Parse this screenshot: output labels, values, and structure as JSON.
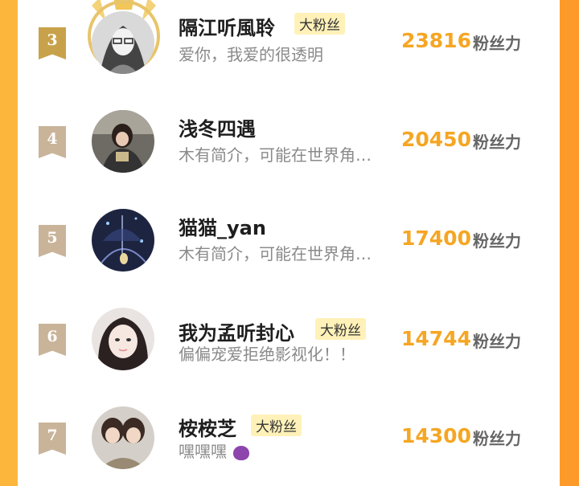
{
  "colors": {
    "accent": "#f5a623",
    "rank_gold": "#c8a24a",
    "rank_other": "#c9b49a",
    "badge_bg": "#fff1b8",
    "frame": "#fdb63c"
  },
  "rows": [
    {
      "rank": "3",
      "name": "隔江听風聆",
      "badge": "大粉丝",
      "bio": "爱你，我爱的很透明",
      "score": "23816",
      "unit": "粉丝力"
    },
    {
      "rank": "4",
      "name": "浅冬四遇",
      "badge": "",
      "bio": "木有简介，可能在世界角…",
      "score": "20450",
      "unit": "粉丝力"
    },
    {
      "rank": "5",
      "name": "猫猫_yan",
      "badge": "",
      "bio": "木有简介，可能在世界角…",
      "score": "17400",
      "unit": "粉丝力"
    },
    {
      "rank": "6",
      "name": "我为孟听封心",
      "badge": "大粉丝",
      "bio": "偏偏宠爱拒绝影视化！！",
      "score": "14744",
      "unit": "粉丝力"
    },
    {
      "rank": "7",
      "name": "桉桉芝",
      "badge": "大粉丝",
      "bio": "嘿嘿嘿",
      "bio_icon": "devil-emoji-icon",
      "score": "14300",
      "unit": "粉丝力"
    }
  ]
}
